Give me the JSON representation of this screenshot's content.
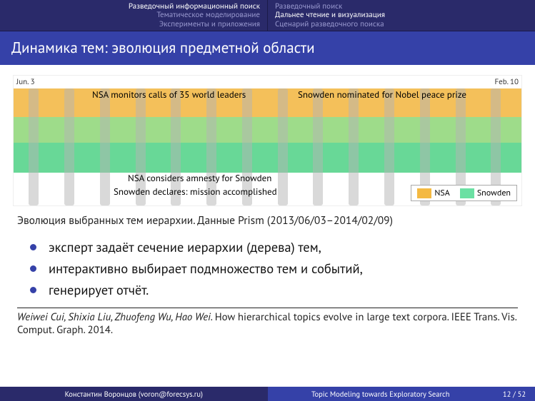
{
  "nav": {
    "left": [
      {
        "label": "Разведочный информационный поиск",
        "active": true
      },
      {
        "label": "Тематическое моделирование",
        "active": false
      },
      {
        "label": "Эксперименты и приложения",
        "active": false
      }
    ],
    "right": [
      {
        "label": "Разведочный поиск",
        "active": false
      },
      {
        "label": "Дальнее чтение и визуализация",
        "active": true
      },
      {
        "label": "Сценарий разведочного поиска",
        "active": false
      }
    ]
  },
  "title": "Динамика тем: эволюция предметной области",
  "figure": {
    "date_left": "Jun. 3",
    "date_right": "Feb. 10",
    "annotations": {
      "a1": "NSA monitors calls of 35 world leaders",
      "a2": "Snowden nominated for Nobel peace prize",
      "a3": "NSA considers amnesty for Snowden",
      "a4": "Snowden declares: mission accomplished"
    },
    "legend": {
      "item1": "NSA",
      "item2": "Snowden"
    }
  },
  "caption": "Эволюция выбранных тем иерархии. Данные Prism (2013/06/03–2014/02/09)",
  "bullets": {
    "b1": "эксперт задаёт сечение иерархии (дерева) тем,",
    "b2": "интерактивно выбирает подмножество тем и событий,",
    "b3": "генерирует отчёт."
  },
  "reference": {
    "authors": "Weiwei Cui, Shixia Liu, Zhuofeng Wu, Hao Wei.",
    "title": "How hierarchical topics evolve in large text corpora. IEEE Trans. Vis. Comput. Graph. 2014."
  },
  "footer": {
    "author": "Константин Воронцов (voron@forecsys.ru)",
    "talk": "Topic Modeling towards Exploratory Search",
    "page": "12 / 52"
  },
  "chart_data": {
    "type": "area",
    "title": "Evolution of selected hierarchy topics (Prism dataset)",
    "x_range": [
      "2013-06-03",
      "2014-02-10"
    ],
    "series": [
      {
        "name": "NSA",
        "color": "#f4b942"
      },
      {
        "name": "Snowden",
        "color": "#6be0a3"
      }
    ],
    "events": [
      {
        "label": "NSA monitors calls of 35 world leaders",
        "approx_date": "2013-10"
      },
      {
        "label": "Snowden nominated for Nobel peace prize",
        "approx_date": "2014-01"
      },
      {
        "label": "NSA considers amnesty for Snowden",
        "approx_date": "2013-12"
      },
      {
        "label": "Snowden declares: mission accomplished",
        "approx_date": "2013-12"
      }
    ]
  }
}
